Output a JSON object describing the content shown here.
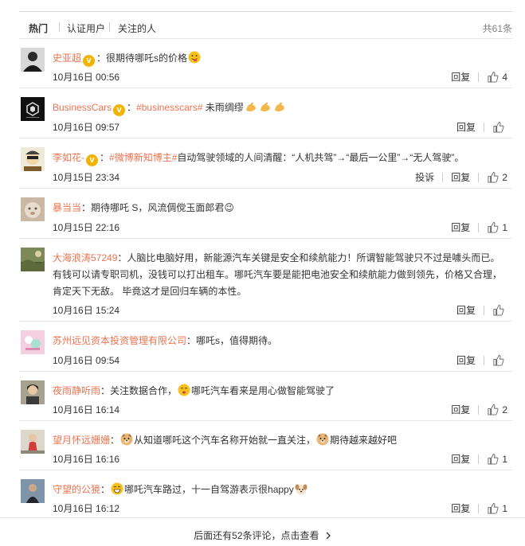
{
  "tabs": [
    {
      "label": "热门"
    },
    {
      "label": "认证用户"
    },
    {
      "label": "关注的人"
    }
  ],
  "total_label": "共61条",
  "actions": {
    "reply": "回复",
    "report": "投诉"
  },
  "comments": [
    {
      "user": "史亚超",
      "verified": true,
      "text": "：很期待哪吒s的价格",
      "emoji_after": "tongue-face-emoji",
      "time": "10月16日 00:56",
      "likes": "4"
    },
    {
      "user": "BusinessCars",
      "verified": true,
      "text_prefix": "：",
      "topic": "#businesscars#",
      "text": " 未雨绸缪",
      "emoji_after": "flex-arm-emoji",
      "time": "10月16日 09:57",
      "likes": ""
    },
    {
      "user": "李如花-",
      "verified": true,
      "text_prefix": "：",
      "topic": "#微博新知博主#",
      "text": "自动驾驶领域的人间清醒：“人机共驾”→“最后一公里”→“无人驾驶”。",
      "time": "10月15日 23:34",
      "likes": "2"
    },
    {
      "user": "暴当当",
      "verified": false,
      "text": "：期待哪吒 S，风流倜傥玉面郎君😉",
      "time": "10月15日 22:16",
      "likes": "1"
    },
    {
      "user": "大海浪涛57249",
      "verified": false,
      "text": "：人脑比电脑好用，新能源汽车关键是安全和续航能力！所谓智能驾驶只不过是噱头而已。有钱可以请专职司机，没钱可以打出租车。哪吒汽车要是能把电池安全和续航能力做到领先，价格又合理，肯定天下无敌。 毕竟这才是回归车辆的本性。",
      "time": "10月16日 15:24",
      "likes": ""
    },
    {
      "user": "苏州远见资本投资管理有限公司",
      "verified": false,
      "text": "：哪吒s，值得期待。",
      "time": "10月16日 09:54",
      "likes": ""
    },
    {
      "user": "夜雨静听雨",
      "verified": false,
      "text_prefix": "：关注数据合作，",
      "text": "哪吒汽车看来是用心做智能驾驶了",
      "time": "10月16日 16:14",
      "likes": "2"
    },
    {
      "user": "望月怀远姗姗",
      "verified": false,
      "text_prefix": "：",
      "text": "从知道哪吒这个汽车名称开始就一直关注，",
      "text_suffix": "期待越来越好吧",
      "time": "10月16日 16:16",
      "likes": "1"
    },
    {
      "user": "守望的公獍",
      "verified": false,
      "text_prefix": "：",
      "text": "哪吒汽车路过，十一自驾游表示很happy",
      "time": "10月16日 16:12",
      "likes": "1"
    }
  ],
  "more_label": "后面还有52条评论，点击查看",
  "colors": {
    "link": "#eb7350",
    "badge": "#f1b300",
    "divider": "#e6e6e6"
  }
}
